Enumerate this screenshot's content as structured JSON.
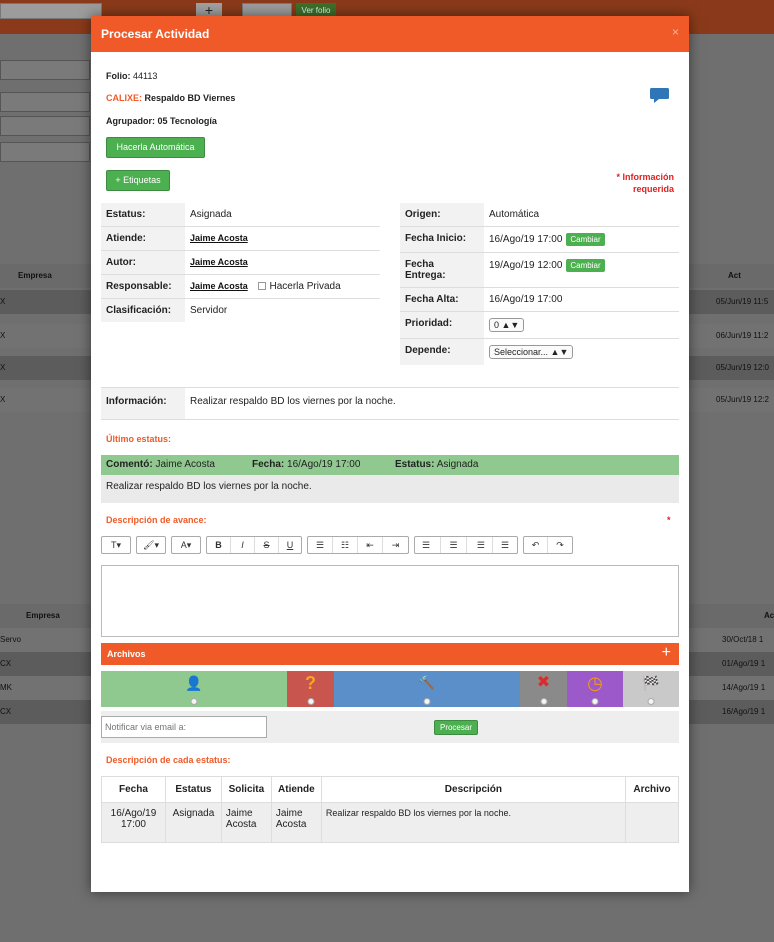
{
  "background": {
    "top_button": "+",
    "top_link": "Ver folio",
    "table1_headers": [
      "Empresa",
      "Act"
    ],
    "table1_rows": [
      {
        "empresa": "X",
        "fecha": "05/Jun/19 11:5"
      },
      {
        "empresa": "X",
        "fecha": "06/Jun/19 11:2"
      },
      {
        "empresa": "X",
        "fecha": "05/Jun/19 12:0"
      },
      {
        "empresa": "X",
        "fecha": "05/Jun/19 12:2"
      }
    ],
    "table2_headers": [
      "Empresa",
      "Ac"
    ],
    "table2_rows": [
      {
        "empresa": "Servo",
        "fecha": "30/Oct/18 1"
      },
      {
        "empresa": "CX",
        "fecha": "01/Ago/19 1"
      },
      {
        "empresa": "MK",
        "fecha": "14/Ago/19 1"
      },
      {
        "empresa": "CX",
        "fecha": "16/Ago/19 1"
      }
    ]
  },
  "modal": {
    "title": "Procesar Actividad",
    "close": "×",
    "folio_label": "Folio:",
    "folio": "44113",
    "company": "CALIXE:",
    "activity": "Respaldo BD Viernes",
    "group_label": "Agrupador:",
    "group": "05 Tecnología",
    "btn_auto": "Hacerla Automática",
    "btn_tags": "+ Etiquetas",
    "required_note_1": "* Información",
    "required_note_2": "requerida",
    "left_fields": {
      "estatus_label": "Estatus:",
      "estatus": "Asignada",
      "atiende_label": "Atiende:",
      "atiende": "Jaime Acosta",
      "autor_label": "Autor:",
      "autor": "Jaime Acosta",
      "responsable_label": "Responsable:",
      "responsable": "Jaime Acosta",
      "privada_label": "Hacerla Privada",
      "clasificacion_label": "Clasificación:",
      "clasificacion": "Servidor"
    },
    "right_fields": {
      "origen_label": "Origen:",
      "origen": "Automática",
      "inicio_label": "Fecha Inicio:",
      "inicio": "16/Ago/19 17:00",
      "entrega_label_1": "Fecha",
      "entrega_label_2": "Entrega:",
      "entrega": "19/Ago/19 12:00",
      "cambiar": "Cambiar",
      "alta_label": "Fecha Alta:",
      "alta": "16/Ago/19 17:00",
      "prioridad_label": "Prioridad:",
      "prioridad": "0 ▲▼",
      "depende_label": "Depende:",
      "depende": "Seleccionar... ▲▼"
    },
    "info_label": "Información:",
    "info": "Realizar respaldo BD los viernes por la noche.",
    "last_status_title": "Último estatus:",
    "last_status": {
      "comento_label": "Comentó:",
      "comento": "Jaime Acosta",
      "fecha_label": "Fecha:",
      "fecha": "16/Ago/19 17:00",
      "estatus_label": "Estatus:",
      "estatus": "Asignada",
      "desc": "Realizar respaldo BD los viernes por la noche."
    },
    "progress_title": "Descripción de avance:",
    "progress_required": "*",
    "toolbar": {
      "text_style": "T▾",
      "brush": "🖌▾",
      "font": "A▾",
      "bold": "B",
      "italic": "I",
      "strike": "S",
      "underline": "U",
      "ul": "☰",
      "ol": "☷",
      "outdent": "⇤",
      "indent": "⇥",
      "al_left": "☰",
      "al_center": "☰",
      "al_right": "☰",
      "al_justify": "☰",
      "undo": "↶",
      "redo": "↷"
    },
    "archivos": "Archivos",
    "archivos_add": "+",
    "status_options": [
      {
        "icon": "person-check-icon",
        "glyph": "👤",
        "color": "#8fc98f"
      },
      {
        "icon": "question-icon",
        "glyph": "?",
        "color": "#c9554f"
      },
      {
        "icon": "hammer-icon",
        "glyph": "🔨",
        "color": "#5b8fc9"
      },
      {
        "icon": "cancel-icon",
        "glyph": "✖",
        "color": "#8a8a8a"
      },
      {
        "icon": "clock-icon",
        "glyph": "◷",
        "color": "#9b59c9"
      },
      {
        "icon": "finish-flag-icon",
        "glyph": "🏁",
        "color": "#c9c9c9"
      }
    ],
    "notify_placeholder": "Notificar via email a:",
    "btn_process": "Procesar",
    "history_title": "Descripción de cada estatus:",
    "history_headers": [
      "Fecha",
      "Estatus",
      "Solicita",
      "Atiende",
      "Descripción",
      "Archivo"
    ],
    "history_rows": [
      {
        "fecha_1": "16/Ago/19",
        "fecha_2": "17:00",
        "estatus": "Asignada",
        "solicita_1": "Jaime",
        "solicita_2": "Acosta",
        "atiende_1": "Jaime",
        "atiende_2": "Acosta",
        "descripcion": "Realizar respaldo BD los viernes por la noche.",
        "archivo": ""
      }
    ]
  },
  "colors": {
    "accent": "#f05a28",
    "green": "#4caf50",
    "required": "#e02020",
    "status_bar": "#8fc98f"
  }
}
